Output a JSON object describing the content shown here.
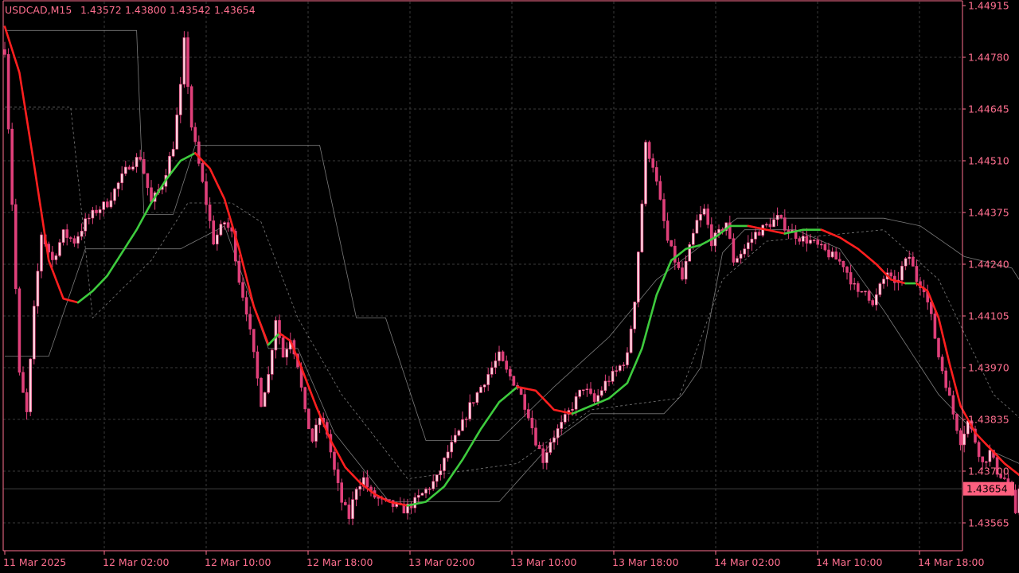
{
  "header": {
    "symbol": "USDCAD,M15",
    "open": "1.43572",
    "high": "1.43800",
    "low": "1.43542",
    "close": "1.43654"
  },
  "colors": {
    "background": "#000000",
    "axis_text": "#ff6f8f",
    "candle": "#e0407a",
    "candle_bull_body": "#ffd0dc",
    "grid": "#3a3a3a",
    "ma_up": "#3ecb3e",
    "ma_down": "#ff1f1f",
    "envelope": "#9a9a9a",
    "price_tag_bg": "#ff5f7f",
    "price_tag_text": "#000000"
  },
  "chart_data": {
    "type": "candlestick",
    "symbol": "USDCAD",
    "timeframe": "M15",
    "y_ticks": [
      "1.44915",
      "1.44780",
      "1.44645",
      "1.44510",
      "1.44375",
      "1.44240",
      "1.44105",
      "1.43970",
      "1.43835",
      "1.43700",
      "1.43565"
    ],
    "ylim": [
      1.4354,
      1.4492
    ],
    "x_ticks": [
      "11 Mar 2025",
      "12 Mar 02:00",
      "12 Mar 10:00",
      "12 Mar 18:00",
      "13 Mar 02:00",
      "13 Mar 10:00",
      "13 Mar 18:00",
      "14 Mar 02:00",
      "14 Mar 10:00",
      "14 Mar 18:00"
    ],
    "current_price": "1.43654",
    "close_path": [
      [
        0,
        1.448
      ],
      [
        2,
        1.444
      ],
      [
        4,
        1.4395
      ],
      [
        6,
        1.4385
      ],
      [
        8,
        1.4412
      ],
      [
        10,
        1.4432
      ],
      [
        13,
        1.4425
      ],
      [
        16,
        1.4432
      ],
      [
        19,
        1.443
      ],
      [
        22,
        1.4435
      ],
      [
        25,
        1.4438
      ],
      [
        28,
        1.444
      ],
      [
        31,
        1.4445
      ],
      [
        34,
        1.445
      ],
      [
        37,
        1.4452
      ],
      [
        40,
        1.444
      ],
      [
        43,
        1.4445
      ],
      [
        46,
        1.4455
      ],
      [
        48,
        1.447
      ],
      [
        49,
        1.4482
      ],
      [
        51,
        1.446
      ],
      [
        53,
        1.445
      ],
      [
        55,
        1.444
      ],
      [
        57,
        1.443
      ],
      [
        60,
        1.4435
      ],
      [
        62,
        1.4432
      ],
      [
        64,
        1.442
      ],
      [
        66,
        1.4412
      ],
      [
        68,
        1.44
      ],
      [
        70,
        1.4388
      ],
      [
        72,
        1.4395
      ],
      [
        74,
        1.441
      ],
      [
        76,
        1.44
      ],
      [
        78,
        1.4405
      ],
      [
        80,
        1.4398
      ],
      [
        82,
        1.4385
      ],
      [
        84,
        1.4378
      ],
      [
        86,
        1.4384
      ],
      [
        88,
        1.438
      ],
      [
        90,
        1.437
      ],
      [
        92,
        1.4362
      ],
      [
        94,
        1.4358
      ],
      [
        96,
        1.4366
      ],
      [
        98,
        1.4368
      ],
      [
        100,
        1.4364
      ],
      [
        103,
        1.4362
      ],
      [
        106,
        1.4361
      ],
      [
        109,
        1.436
      ],
      [
        112,
        1.4362
      ],
      [
        115,
        1.4365
      ],
      [
        118,
        1.4368
      ],
      [
        121,
        1.4375
      ],
      [
        124,
        1.438
      ],
      [
        127,
        1.4387
      ],
      [
        130,
        1.4392
      ],
      [
        133,
        1.4397
      ],
      [
        135,
        1.44
      ],
      [
        137,
        1.4396
      ],
      [
        140,
        1.4392
      ],
      [
        143,
        1.4385
      ],
      [
        145,
        1.4378
      ],
      [
        147,
        1.4373
      ],
      [
        149,
        1.4378
      ],
      [
        152,
        1.4382
      ],
      [
        155,
        1.4387
      ],
      [
        158,
        1.4392
      ],
      [
        161,
        1.4388
      ],
      [
        164,
        1.4393
      ],
      [
        167,
        1.4396
      ],
      [
        170,
        1.44
      ],
      [
        172,
        1.4415
      ],
      [
        174,
        1.444
      ],
      [
        175,
        1.4455
      ],
      [
        177,
        1.445
      ],
      [
        179,
        1.444
      ],
      [
        181,
        1.443
      ],
      [
        183,
        1.4425
      ],
      [
        185,
        1.442
      ],
      [
        187,
        1.4428
      ],
      [
        189,
        1.4435
      ],
      [
        191,
        1.4438
      ],
      [
        193,
        1.443
      ],
      [
        195,
        1.4432
      ],
      [
        197,
        1.4435
      ],
      [
        199,
        1.4425
      ],
      [
        202,
        1.4428
      ],
      [
        205,
        1.4432
      ],
      [
        208,
        1.4434
      ],
      [
        211,
        1.4436
      ],
      [
        214,
        1.4433
      ],
      [
        217,
        1.4431
      ],
      [
        220,
        1.443
      ],
      [
        223,
        1.4428
      ],
      [
        226,
        1.4426
      ],
      [
        229,
        1.4424
      ],
      [
        231,
        1.442
      ],
      [
        233,
        1.4416
      ],
      [
        235,
        1.4418
      ],
      [
        237,
        1.4413
      ],
      [
        239,
        1.4418
      ],
      [
        241,
        1.4422
      ],
      [
        243,
        1.4418
      ],
      [
        245,
        1.4423
      ],
      [
        247,
        1.4426
      ],
      [
        249,
        1.442
      ],
      [
        251,
        1.4418
      ],
      [
        253,
        1.441
      ],
      [
        255,
        1.44
      ],
      [
        257,
        1.4393
      ],
      [
        259,
        1.4385
      ],
      [
        261,
        1.4378
      ],
      [
        263,
        1.4383
      ],
      [
        265,
        1.4378
      ],
      [
        267,
        1.4372
      ],
      [
        269,
        1.4375
      ],
      [
        271,
        1.437
      ],
      [
        273,
        1.4368
      ],
      [
        275,
        1.4364
      ],
      [
        276,
        1.4358
      ],
      [
        277,
        1.43654
      ]
    ],
    "ma_path": [
      [
        0,
        1.4486
      ],
      [
        4,
        1.4474
      ],
      [
        8,
        1.445
      ],
      [
        12,
        1.4425
      ],
      [
        16,
        1.4415
      ],
      [
        20,
        1.4414
      ],
      [
        24,
        1.4417
      ],
      [
        28,
        1.4421
      ],
      [
        32,
        1.4427
      ],
      [
        36,
        1.4433
      ],
      [
        40,
        1.444
      ],
      [
        44,
        1.4446
      ],
      [
        48,
        1.4451
      ],
      [
        52,
        1.4453
      ],
      [
        56,
        1.4449
      ],
      [
        60,
        1.4441
      ],
      [
        64,
        1.4428
      ],
      [
        68,
        1.4413
      ],
      [
        72,
        1.4403
      ],
      [
        75,
        1.4406
      ],
      [
        78,
        1.4404
      ],
      [
        81,
        1.4397
      ],
      [
        85,
        1.4387
      ],
      [
        89,
        1.4378
      ],
      [
        93,
        1.4371
      ],
      [
        97,
        1.4367
      ],
      [
        101,
        1.4364
      ],
      [
        105,
        1.4362
      ],
      [
        110,
        1.4361
      ],
      [
        115,
        1.4362
      ],
      [
        120,
        1.4366
      ],
      [
        125,
        1.4373
      ],
      [
        130,
        1.4381
      ],
      [
        135,
        1.4388
      ],
      [
        140,
        1.4392
      ],
      [
        145,
        1.4391
      ],
      [
        150,
        1.4386
      ],
      [
        155,
        1.4385
      ],
      [
        160,
        1.4387
      ],
      [
        165,
        1.4389
      ],
      [
        170,
        1.4393
      ],
      [
        174,
        1.4402
      ],
      [
        178,
        1.4416
      ],
      [
        182,
        1.4425
      ],
      [
        186,
        1.4428
      ],
      [
        190,
        1.4429
      ],
      [
        194,
        1.4431
      ],
      [
        198,
        1.4434
      ],
      [
        203,
        1.4434
      ],
      [
        208,
        1.4433
      ],
      [
        213,
        1.4432
      ],
      [
        218,
        1.4433
      ],
      [
        223,
        1.4433
      ],
      [
        228,
        1.4431
      ],
      [
        233,
        1.4428
      ],
      [
        238,
        1.4424
      ],
      [
        242,
        1.442
      ],
      [
        246,
        1.4419
      ],
      [
        249,
        1.4419
      ],
      [
        252,
        1.4417
      ],
      [
        255,
        1.441
      ],
      [
        258,
        1.4398
      ],
      [
        261,
        1.4387
      ],
      [
        265,
        1.438
      ],
      [
        269,
        1.4376
      ],
      [
        273,
        1.4372
      ],
      [
        277,
        1.4369
      ]
    ],
    "band_upper": [
      [
        0,
        1.4485
      ],
      [
        30,
        1.4485
      ],
      [
        36,
        1.4485
      ],
      [
        38,
        1.4437
      ],
      [
        46,
        1.4437
      ],
      [
        52,
        1.4455
      ],
      [
        86,
        1.4455
      ],
      [
        96,
        1.441
      ],
      [
        104,
        1.441
      ],
      [
        115,
        1.4378
      ],
      [
        135,
        1.4378
      ],
      [
        150,
        1.4392
      ],
      [
        165,
        1.4405
      ],
      [
        178,
        1.442
      ],
      [
        200,
        1.4436
      ],
      [
        240,
        1.4436
      ],
      [
        250,
        1.4434
      ],
      [
        262,
        1.4426
      ],
      [
        275,
        1.4423
      ],
      [
        277,
        1.442
      ]
    ],
    "band_lower": [
      [
        0,
        1.44
      ],
      [
        12,
        1.44
      ],
      [
        22,
        1.4428
      ],
      [
        48,
        1.4428
      ],
      [
        60,
        1.4434
      ],
      [
        72,
        1.4402
      ],
      [
        80,
        1.4402
      ],
      [
        90,
        1.438
      ],
      [
        105,
        1.4362
      ],
      [
        135,
        1.4362
      ],
      [
        150,
        1.4378
      ],
      [
        160,
        1.4385
      ],
      [
        180,
        1.4385
      ],
      [
        185,
        1.439
      ],
      [
        190,
        1.4397
      ],
      [
        196,
        1.4427
      ],
      [
        202,
        1.4433
      ],
      [
        216,
        1.4433
      ],
      [
        228,
        1.4428
      ],
      [
        240,
        1.4412
      ],
      [
        255,
        1.439
      ],
      [
        270,
        1.4375
      ],
      [
        277,
        1.4372
      ]
    ],
    "band_mid": [
      [
        0,
        1.4465
      ],
      [
        18,
        1.4465
      ],
      [
        24,
        1.441
      ],
      [
        40,
        1.4425
      ],
      [
        50,
        1.444
      ],
      [
        62,
        1.444
      ],
      [
        70,
        1.4435
      ],
      [
        80,
        1.441
      ],
      [
        92,
        1.439
      ],
      [
        110,
        1.4368
      ],
      [
        140,
        1.4372
      ],
      [
        160,
        1.4386
      ],
      [
        184,
        1.4389
      ],
      [
        196,
        1.442
      ],
      [
        208,
        1.443
      ],
      [
        240,
        1.4433
      ],
      [
        255,
        1.442
      ],
      [
        270,
        1.439
      ],
      [
        277,
        1.4384
      ]
    ]
  }
}
